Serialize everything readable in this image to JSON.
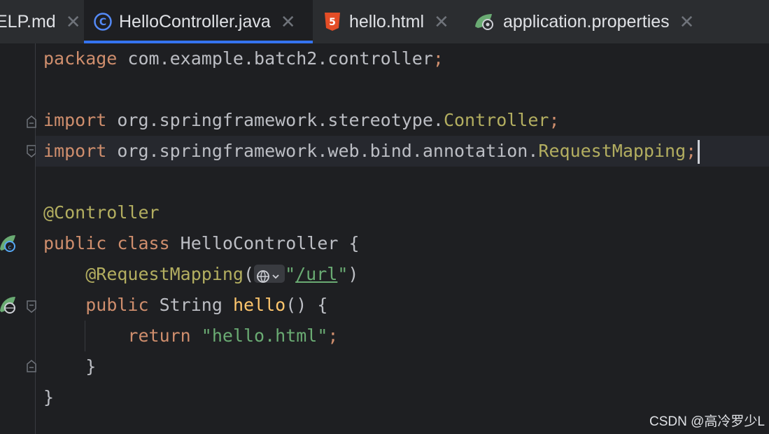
{
  "tabs": [
    {
      "label": "ELP.md",
      "icon": "markdown-icon",
      "active": false
    },
    {
      "label": "HelloController.java",
      "icon": "java-class-icon",
      "active": true
    },
    {
      "label": "hello.html",
      "icon": "html5-icon",
      "active": false
    },
    {
      "label": "application.properties",
      "icon": "spring-properties-icon",
      "active": false
    }
  ],
  "code": {
    "l1": {
      "kw": "package",
      "rest": " com.example.batch2.controller",
      "semi": ";"
    },
    "l3": {
      "kw": "import",
      "pkg": " org.springframework.stereotype.",
      "cls": "Controller",
      "semi": ";"
    },
    "l4": {
      "kw": "import",
      "pkg": " org.springframework.web.bind.annotation.",
      "cls": "RequestMapping",
      "semi": ";"
    },
    "l6": {
      "ann": "@Controller"
    },
    "l7": {
      "kw": "public class",
      "name": " HelloController {"
    },
    "l8": {
      "ann": "@RequestMapping",
      "open": "(",
      "q1": "\"",
      "url": "/url",
      "q2": "\"",
      "close": ")"
    },
    "l9": {
      "kw": "public",
      "type": " String ",
      "method": "hello",
      "rest": "() {"
    },
    "l10": {
      "kw": "return",
      "str": " \"hello.html\"",
      "semi": ";"
    },
    "l11": {
      "text": "}"
    },
    "l12": {
      "text": "}"
    }
  },
  "watermark": "CSDN @高冷罗少L",
  "colors": {
    "background": "#1e1f22",
    "keyword": "#cf8e6d",
    "annotation": "#b3ae60",
    "string": "#6aab73",
    "tab_accent": "#3574f0"
  }
}
